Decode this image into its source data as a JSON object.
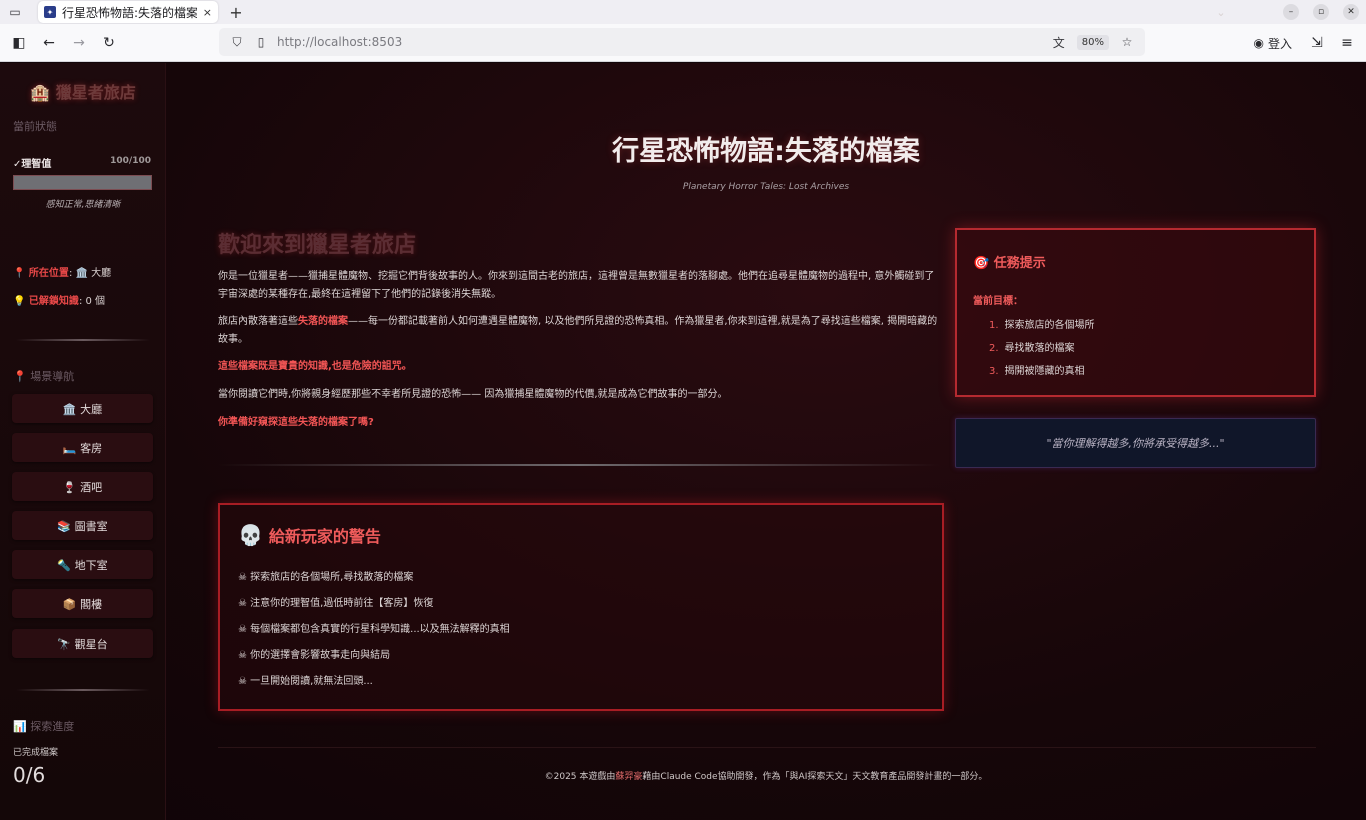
{
  "browser": {
    "tab_title": "行星恐怖物語:失落的檔案",
    "tab_close": "×",
    "new_tab": "+",
    "url": "http://localhost:8503",
    "zoom": "80%",
    "login": "登入"
  },
  "sidebar": {
    "title": "🏨 獵星者旅店",
    "status_header": "當前狀態",
    "sanity_label": "✓理智值",
    "sanity_value": "100/100",
    "sanity_fraction": 1.0,
    "sanity_status": "感知正常,思緒清晰",
    "location_key": "📍 所在位置",
    "location_val": ": 🏛️ 大廳",
    "knowledge_key": "💡 已解鎖知識",
    "knowledge_val": ": 0 個",
    "nav_header": "📍 場景導航",
    "nav_items": [
      "🏛️ 大廳",
      "🛏️ 客房",
      "🍷 酒吧",
      "📚 圖書室",
      "🔦 地下室",
      "📦 閣樓",
      "🔭 觀星台"
    ],
    "progress_header": "📊 探索進度",
    "progress_label": "已完成檔案",
    "progress_value": "0/6"
  },
  "main": {
    "title": "行星恐怖物語:失落的檔案",
    "subtitle": "Planetary Horror Tales: Lost Archives",
    "welcome_heading": "歡迎來到獵星者旅店",
    "para1": "你是一位獵星者——獵捕星體魔物、挖掘它們背後故事的人。你來到這間古老的旅店，這裡曾是無數獵星者的落腳處。他們在追尋星體魔物的過程中, 意外觸碰到了宇宙深處的某種存在,最終在這裡留下了他們的記錄後消失無蹤。",
    "para2_a": "旅店內散落著這些",
    "para2_hl": "失落的檔案",
    "para2_b": "——每一份都記載著前人如何遭遇星體魔物, 以及他們所見證的恐怖真相。作為獵星者,你來到這裡,就是為了尋找這些檔案, 揭開暗藏的故事。",
    "para3": "這些檔案既是寶貴的知識,也是危險的詛咒。",
    "para4": "當你閱讀它們時,你將親身經歷那些不幸者所見證的恐怖—— 因為獵捕星體魔物的代價,就是成為它們故事的一部分。",
    "para5": "你準備好窺探這些失落的檔案了嗎?"
  },
  "warning": {
    "icon": "💀",
    "title": "給新玩家的警告",
    "items": [
      "☠ 探索旅店的各個場所,尋找散落的檔案",
      "☠ 注意你的理智值,過低時前往【客房】恢復",
      "☠ 每個檔案都包含真實的行星科學知識...以及無法解釋的真相",
      "☠ 你的選擇會影響故事走向與結局",
      "☠ 一旦開始閱讀,就無法回頭..."
    ]
  },
  "mission": {
    "title": "🎯 任務提示",
    "subtitle": "當前目標：",
    "items": [
      {
        "num": "1.",
        "text": "探索旅店的各個場所"
      },
      {
        "num": "2.",
        "text": "尋找散落的檔案"
      },
      {
        "num": "3.",
        "text": "揭開被隱藏的真相"
      }
    ]
  },
  "quote": "\"當你理解得越多,你將承受得越多...\"",
  "footer": {
    "a": "©2025 本遊戲由",
    "link": "蘇羿豪",
    "b": "藉由Claude Code協助開發，作為「與AI探索天文」天文教育產品開發計畫的一部分。"
  },
  "colors": {
    "accent_red": "#ef5b5b",
    "border_red": "#a81d24",
    "background": "#160609"
  }
}
